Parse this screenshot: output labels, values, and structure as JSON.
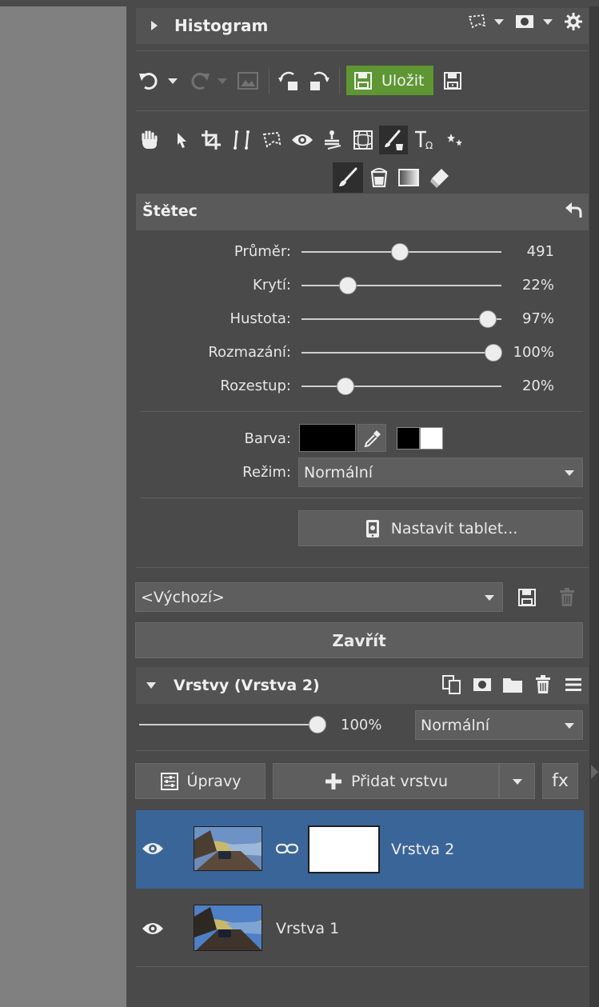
{
  "histogram": {
    "title": "Histogram"
  },
  "toolbar": {
    "save_label": "Uložit"
  },
  "brush": {
    "title": "Štětec",
    "sliders": [
      {
        "label": "Průměr:",
        "value": "491",
        "level": 0.49
      },
      {
        "label": "Krytí:",
        "value": "22%",
        "level": 0.23
      },
      {
        "label": "Hustota:",
        "value": "97%",
        "level": 0.93
      },
      {
        "label": "Rozmazání:",
        "value": "100%",
        "level": 0.96
      },
      {
        "label": "Rozestup:",
        "value": "20%",
        "level": 0.22
      }
    ],
    "color_label": "Barva:",
    "mode_label": "Režim:",
    "mode_value": "Normální",
    "tablet_button": "Nastavit tablet...",
    "preset_value": "<Výchozí>",
    "close_button": "Zavřít",
    "colors": {
      "primary": "#000000",
      "secondary": "#ffffff"
    }
  },
  "layers": {
    "title": "Vrstvy (Vrstva 2)",
    "opacity": "100%",
    "opacity_level": 1.0,
    "blend_mode": "Normální",
    "adjust_button": "Úpravy",
    "add_layer_button": "Přidat vrstvu",
    "fx_button": "fx",
    "items": [
      {
        "name": "Vrstva 2",
        "selected": true,
        "has_mask": true
      },
      {
        "name": "Vrstva 1",
        "selected": false,
        "has_mask": false
      }
    ]
  },
  "colors": {
    "accent_green": "#5d9632",
    "selection_blue": "#3a6598",
    "panel_bg": "#4a4a4a",
    "header_bg": "#535353"
  }
}
